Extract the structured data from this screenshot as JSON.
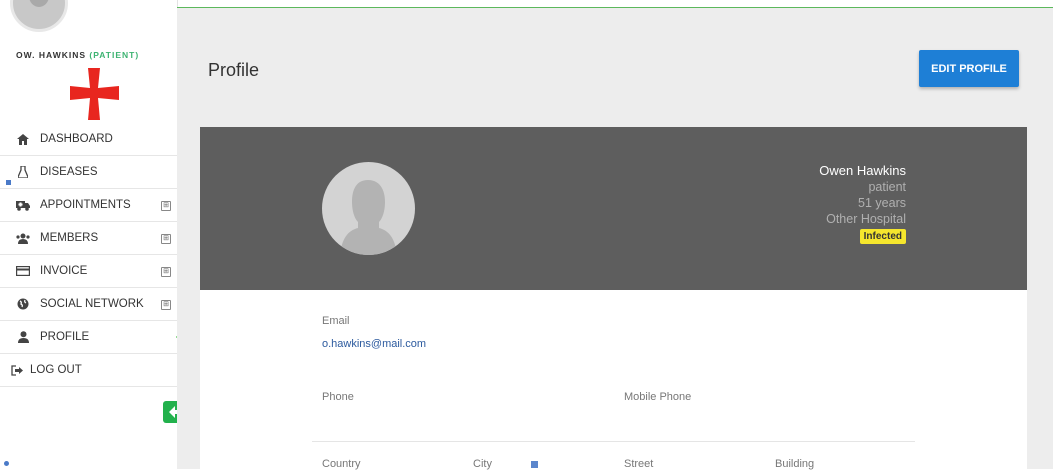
{
  "user": {
    "name_label": "OW. HAWKINS",
    "role_label": "(PATIENT)"
  },
  "sidebar": {
    "items": [
      {
        "label": "DASHBOARD",
        "icon": "home-icon",
        "expandable": false
      },
      {
        "label": "DISEASES",
        "icon": "flask-icon",
        "expandable": false
      },
      {
        "label": "APPOINTMENTS",
        "icon": "ambulance-icon",
        "expandable": true
      },
      {
        "label": "MEMBERS",
        "icon": "users-icon",
        "expandable": true
      },
      {
        "label": "INVOICE",
        "icon": "credit-card-icon",
        "expandable": true
      },
      {
        "label": "SOCIAL NETWORK",
        "icon": "globe-icon",
        "expandable": true
      },
      {
        "label": "PROFILE",
        "icon": "user-icon",
        "expandable": false,
        "active": true
      }
    ],
    "logout_label": "LOG OUT",
    "plus_symbol": "⊞"
  },
  "header": {
    "title": "Profile",
    "edit_button": "EDIT PROFILE"
  },
  "profile": {
    "full_name": "Owen Hawkins",
    "role": "patient",
    "age": "51 years",
    "hospital": "Other Hospital",
    "status_badge": "Infected"
  },
  "fields": {
    "email_label": "Email",
    "email_value": "o.hawkins@mail.com",
    "phone_label": "Phone",
    "mobile_label": "Mobile Phone",
    "country_label": "Country",
    "city_label": "City",
    "street_label": "Street",
    "building_label": "Building"
  },
  "colors": {
    "accent_green": "#22b14c",
    "primary_blue": "#1e7fd6",
    "header_gray": "#5e5e5e",
    "badge_yellow": "#f5e62d",
    "logo_red": "#e8261f"
  }
}
